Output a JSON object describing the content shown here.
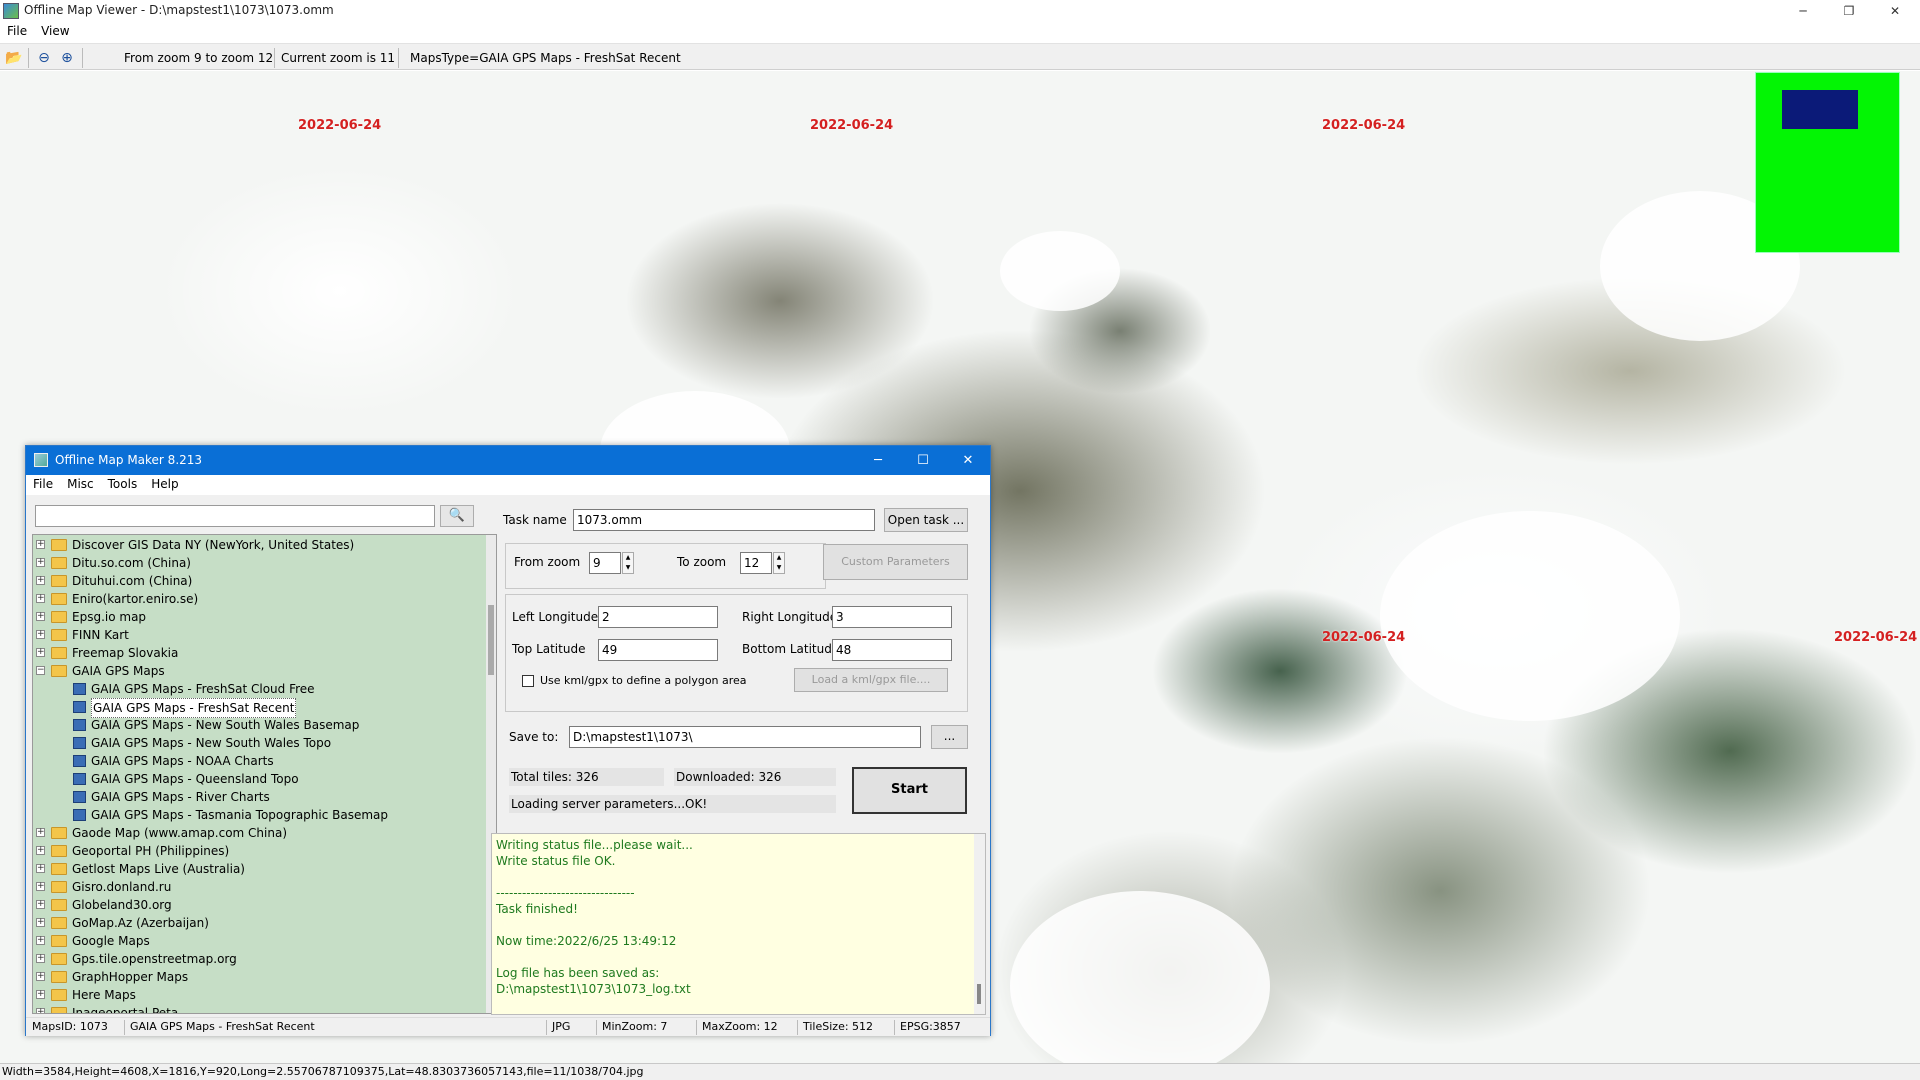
{
  "viewer": {
    "title": "Offline Map Viewer - D:\\mapstest1\\1073\\1073.omm",
    "window_buttons": {
      "minimize": "─",
      "restore": "❐",
      "close": "✕"
    },
    "menu": [
      "File",
      "View"
    ],
    "toolbar": {
      "zoom_range": "From zoom 9 to zoom 12",
      "current_zoom": "Current zoom is 11",
      "maps_type": "MapsType=GAIA GPS Maps - FreshSat Recent"
    },
    "map": {
      "date_label": "2022-06-24"
    },
    "status": "Width=3584,Height=4608,X=1816,Y=920,Long=2.55706787109375,Lat=48.8303736057143,file=11/1038/704.jpg"
  },
  "dialog": {
    "title": "Offline Map Maker 8.213",
    "window_buttons": {
      "minimize": "─",
      "maximize": "☐",
      "close": "✕"
    },
    "menu": [
      "File",
      "Misc",
      "Tools",
      "Help"
    ],
    "search": {
      "value": "",
      "icon": "search-icon"
    },
    "tree": {
      "items": [
        {
          "label": "Discover GIS Data NY (NewYork, United States)",
          "type": "folder",
          "expanded": false
        },
        {
          "label": "Ditu.so.com (China)",
          "type": "folder",
          "expanded": false
        },
        {
          "label": "Dituhui.com (China)",
          "type": "folder",
          "expanded": false
        },
        {
          "label": "Eniro(kartor.eniro.se)",
          "type": "folder",
          "expanded": false
        },
        {
          "label": "Epsg.io map",
          "type": "folder",
          "expanded": false
        },
        {
          "label": "FINN Kart",
          "type": "folder",
          "expanded": false
        },
        {
          "label": "Freemap Slovakia",
          "type": "folder",
          "expanded": false
        },
        {
          "label": "GAIA GPS Maps",
          "type": "folder",
          "expanded": true
        },
        {
          "label": "GAIA GPS Maps - FreshSat Cloud Free",
          "type": "map",
          "selected": false
        },
        {
          "label": "GAIA GPS Maps - FreshSat Recent",
          "type": "map",
          "selected": true
        },
        {
          "label": "GAIA GPS Maps - New South Wales Basemap",
          "type": "map",
          "selected": false
        },
        {
          "label": "GAIA GPS Maps - New South Wales Topo",
          "type": "map",
          "selected": false
        },
        {
          "label": "GAIA GPS Maps - NOAA Charts",
          "type": "map",
          "selected": false
        },
        {
          "label": "GAIA GPS Maps - Queensland Topo",
          "type": "map",
          "selected": false
        },
        {
          "label": "GAIA GPS Maps - River Charts",
          "type": "map",
          "selected": false
        },
        {
          "label": "GAIA GPS Maps - Tasmania Topographic Basemap",
          "type": "map",
          "selected": false
        },
        {
          "label": "Gaode Map (www.amap.com China)",
          "type": "folder",
          "expanded": false
        },
        {
          "label": "Geoportal PH (Philippines)",
          "type": "folder",
          "expanded": false
        },
        {
          "label": "Getlost Maps Live (Australia)",
          "type": "folder",
          "expanded": false
        },
        {
          "label": "Gisro.donland.ru",
          "type": "folder",
          "expanded": false
        },
        {
          "label": "Globeland30.org",
          "type": "folder",
          "expanded": false
        },
        {
          "label": "GoMap.Az (Azerbaijan)",
          "type": "folder",
          "expanded": false
        },
        {
          "label": "Google Maps",
          "type": "folder",
          "expanded": false
        },
        {
          "label": "Gps.tile.openstreetmap.org",
          "type": "folder",
          "expanded": false
        },
        {
          "label": "GraphHopper Maps",
          "type": "folder",
          "expanded": false
        },
        {
          "label": "Here Maps",
          "type": "folder",
          "expanded": false
        },
        {
          "label": "Inageoportal Peta",
          "type": "folder",
          "expanded": false
        }
      ]
    },
    "task": {
      "task_name_label": "Task name",
      "task_name": "1073.omm",
      "open_task": "Open task ...",
      "from_zoom_label": "From zoom",
      "from_zoom": "9",
      "to_zoom_label": "To zoom",
      "to_zoom": "12",
      "custom_parameters": "Custom Parameters",
      "left_longitude_label": "Left Longitude",
      "left_longitude": "2",
      "right_longitude_label": "Right Longitude",
      "right_longitude": "3",
      "top_latitude_label": "Top Latitude",
      "top_latitude": "49",
      "bottom_latitude_label": "Bottom Latitude",
      "bottom_latitude": "48",
      "use_kml_label": "Use kml/gpx to define a polygon area",
      "use_kml_checked": false,
      "load_kml": "Load a kml/gpx file....",
      "save_to_label": "Save to:",
      "save_to": "D:\\mapstest1\\1073\\",
      "browse": "...",
      "total_tiles": "Total tiles: 326",
      "downloaded": "Downloaded: 326",
      "loading_status": "Loading server parameters...OK!",
      "start": "Start"
    },
    "log": [
      "Writing status file...please wait...",
      "Write status file OK.",
      "",
      "--------------------------------",
      "Task finished!",
      "",
      "Now time:2022/6/25 13:49:12",
      "",
      "Log file has been saved as:",
      "D:\\mapstest1\\1073\\1073_log.txt"
    ],
    "status": {
      "maps_id": "MapsID: 1073",
      "maps_name": "GAIA GPS Maps - FreshSat Recent",
      "format": "JPG",
      "min_zoom": "MinZoom: 7",
      "max_zoom": "MaxZoom: 12",
      "tile_size": "TileSize: 512",
      "epsg": "EPSG:3857"
    }
  },
  "colors": {
    "dialog_title_bar": "#0a6fd6",
    "tree_background": "#c6dec6",
    "log_background": "#ffffe1",
    "log_text": "#1f7a1f",
    "date_label": "#d42020",
    "overview_background": "#03f504",
    "overview_viewport": "#0b1a78"
  }
}
